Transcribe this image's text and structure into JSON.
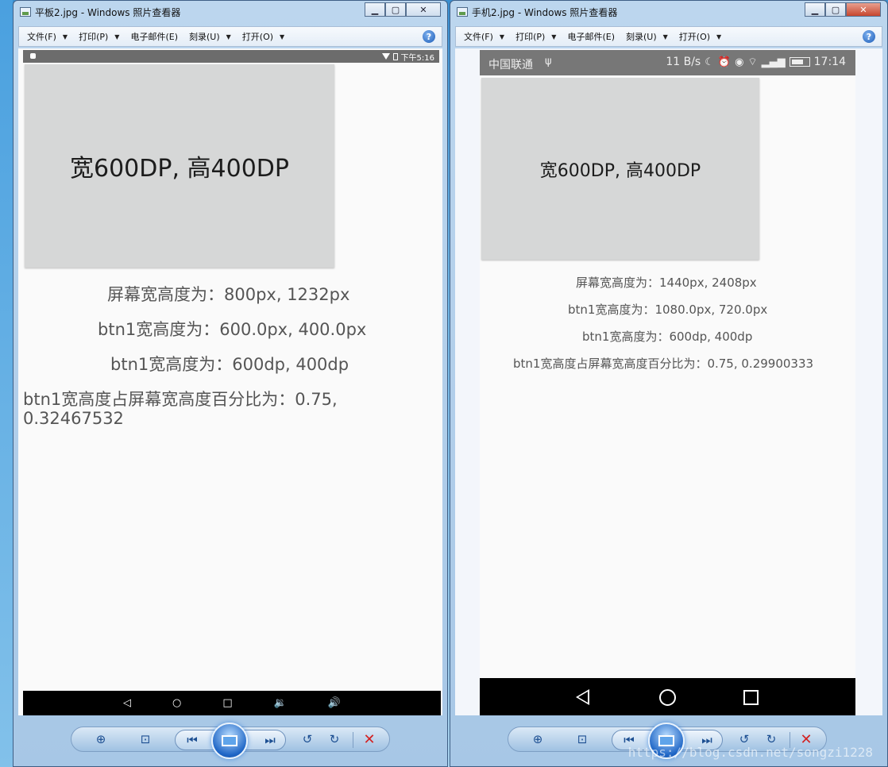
{
  "left_window": {
    "title": "平板2.jpg - Windows 照片查看器",
    "menu": [
      "文件(F)",
      "打印(P)",
      "电子邮件(E)",
      "刻录(U)",
      "打开(O)"
    ],
    "status_time": "下午5:16",
    "button_text": "宽600DP, 高400DP",
    "info": [
      "屏幕宽高度为：800px, 1232px",
      "btn1宽高度为：600.0px, 400.0px",
      "btn1宽高度为：600dp, 400dp",
      "btn1宽高度占屏幕宽高度百分比为：0.75,",
      "0.32467532"
    ]
  },
  "right_window": {
    "title": "手机2.jpg - Windows 照片查看器",
    "menu": [
      "文件(F)",
      "打印(P)",
      "电子邮件(E)",
      "刻录(U)",
      "打开(O)"
    ],
    "carrier": "中国联通",
    "net_speed": "11 B/s",
    "status_time": "17:14",
    "button_text": "宽600DP, 高400DP",
    "info": [
      "屏幕宽高度为：1440px, 2408px",
      "btn1宽高度为：1080.0px, 720.0px",
      "btn1宽高度为：600dp, 400dp",
      "btn1宽高度占屏幕宽高度百分比为：0.75, 0.29900333"
    ]
  },
  "watermark": "https://blog.csdn.net/songzi1228",
  "icons": {
    "zoom": "zoom-icon",
    "fit": "actual-size-icon",
    "prev": "previous-icon",
    "slideshow": "slideshow-icon",
    "next": "next-icon",
    "rotate_ccw": "rotate-ccw-icon",
    "rotate_cw": "rotate-cw-icon",
    "delete": "delete-icon",
    "help": "help-icon"
  }
}
